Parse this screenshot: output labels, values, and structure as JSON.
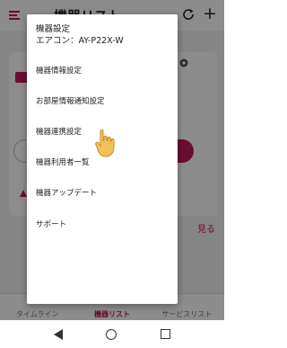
{
  "app": {
    "title": "機器リスト",
    "add_glyph": "+",
    "more_link": "見る",
    "accent": "#c2185b"
  },
  "bottom_nav": {
    "items": [
      {
        "label": "タイムライン",
        "active": false
      },
      {
        "label": "機器リスト",
        "active": true
      },
      {
        "label": "サービスリスト",
        "active": false
      }
    ]
  },
  "popup": {
    "title": "機器設定",
    "subtitle": "エアコン：AY-P22X-W",
    "items": [
      "機器情報設定",
      "お部屋情報通知設定",
      "機器連携設定",
      "機器利用者一覧",
      "機器アップデート",
      "サポート"
    ]
  },
  "icons": {
    "menu": "menu-icon",
    "refresh": "refresh-icon",
    "gear": "gear-icon",
    "pointer": "pointing-hand-icon",
    "back": "back-icon",
    "home": "home-icon",
    "recent": "recent-apps-icon"
  }
}
